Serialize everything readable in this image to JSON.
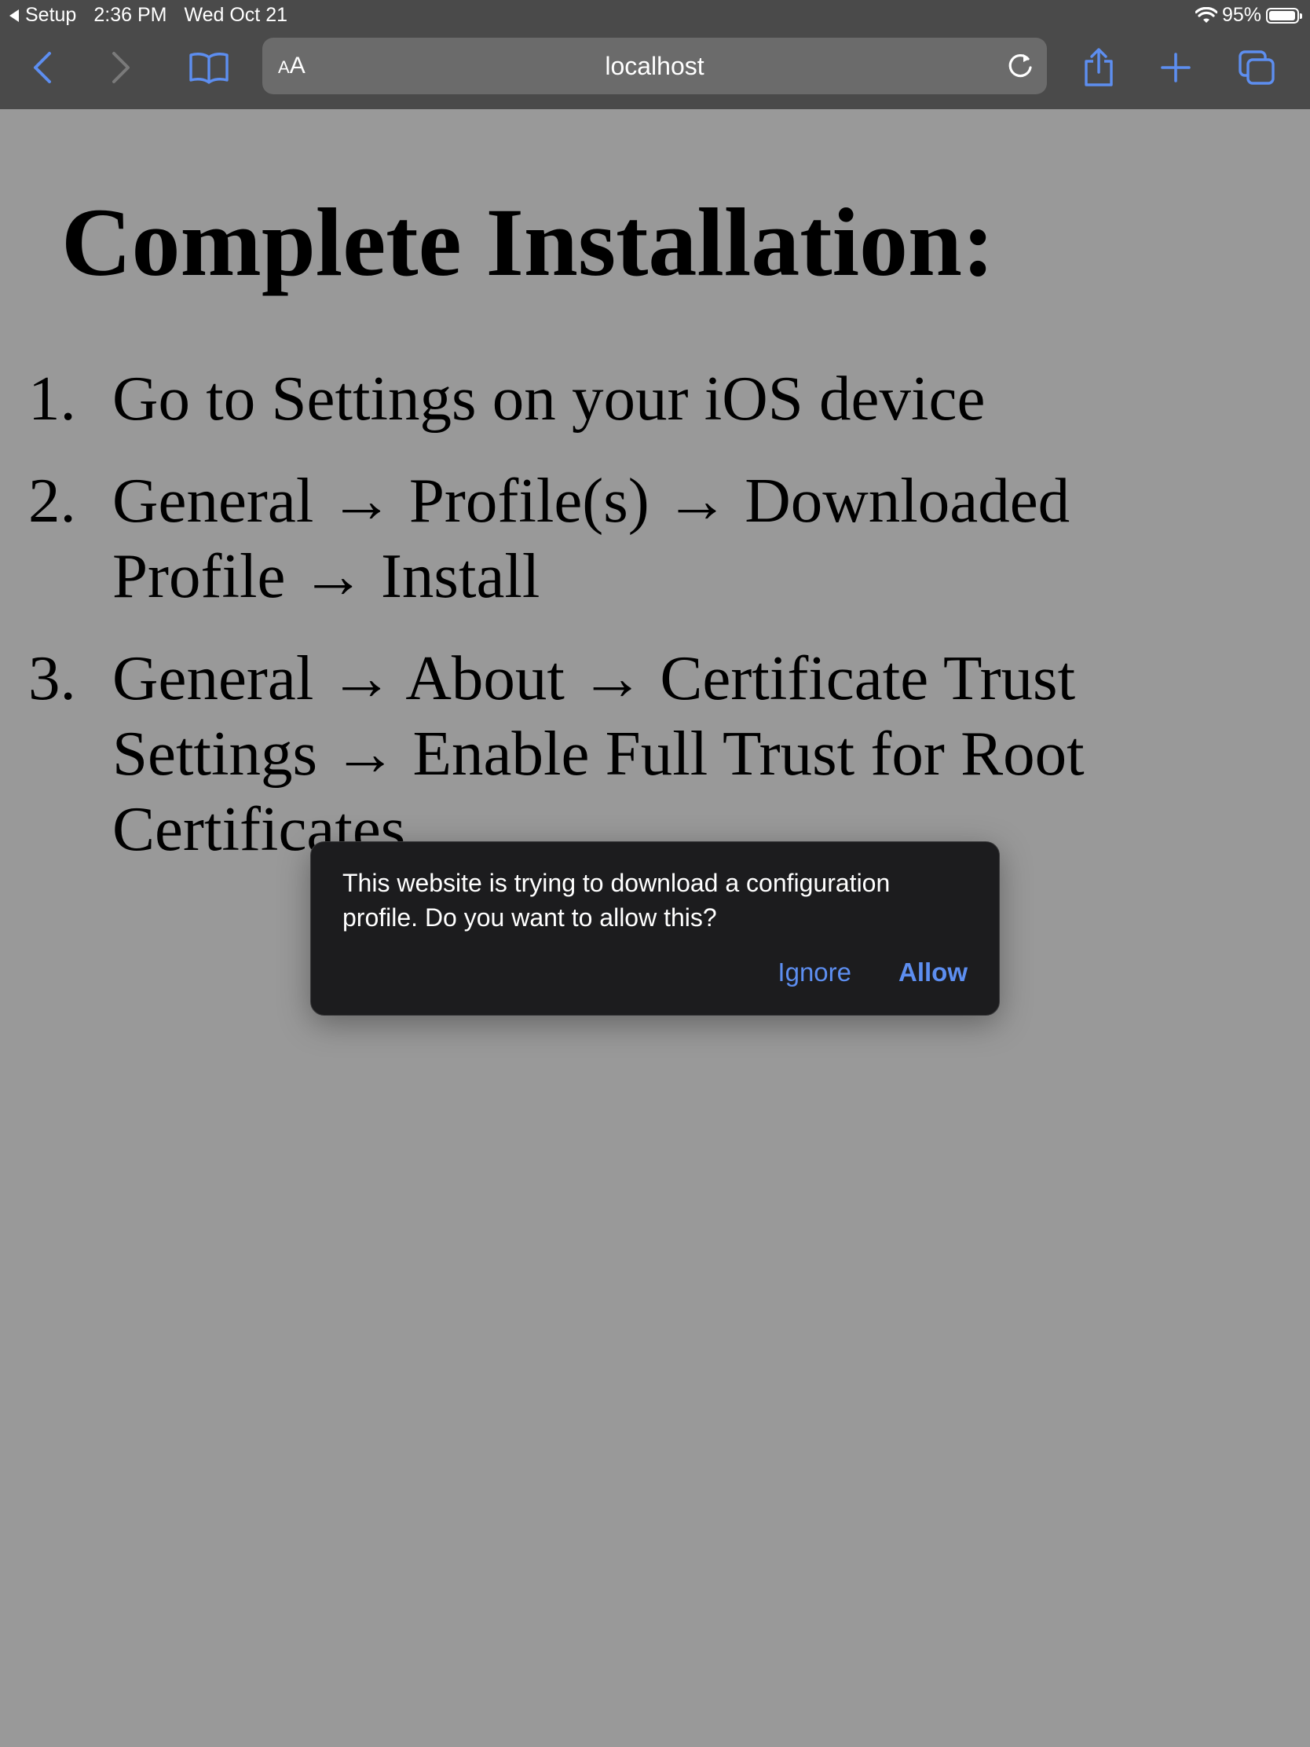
{
  "status_bar": {
    "back_app": "Setup",
    "time": "2:36 PM",
    "date": "Wed Oct 21",
    "battery": "95%"
  },
  "toolbar": {
    "reader_label_small": "A",
    "reader_label_large": "A",
    "url": "localhost"
  },
  "page": {
    "heading": "Complete Installation:",
    "steps": [
      {
        "num": "1.",
        "text": "Go to Settings on your iOS device"
      },
      {
        "num": "2.",
        "text": "General → Profile(s) → Downloaded Profile → Install"
      },
      {
        "num": "3.",
        "text": "General → About → Certificate Trust Settings → Enable Full Trust for Root Certificates"
      }
    ]
  },
  "dialog": {
    "message": "This website is trying to download a configuration profile. Do you want to allow this?",
    "ignore_label": "Ignore",
    "allow_label": "Allow"
  },
  "colors": {
    "chrome": "#4a4a4a",
    "accent": "#5d8ef0",
    "dialog_bg": "#1c1c1e",
    "page_dimmed": "#999999"
  }
}
